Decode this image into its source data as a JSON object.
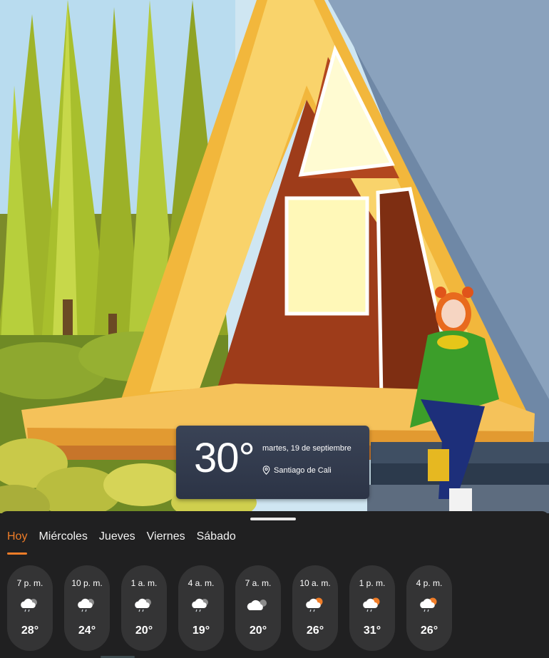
{
  "current": {
    "temperature": "30°",
    "date": "martes, 19 de septiembre",
    "location": "Santiago de Cali",
    "location_icon": "location-pin-icon"
  },
  "tabs": [
    {
      "label": "Hoy",
      "active": true
    },
    {
      "label": "Miércoles",
      "active": false
    },
    {
      "label": "Jueves",
      "active": false
    },
    {
      "label": "Viernes",
      "active": false
    },
    {
      "label": "Sábado",
      "active": false
    }
  ],
  "hourly": [
    {
      "time": "7 p. m.",
      "temp": "28°",
      "icon": "cloud-rain-icon"
    },
    {
      "time": "10 p. m.",
      "temp": "24°",
      "icon": "cloud-rain-icon"
    },
    {
      "time": "1 a. m.",
      "temp": "20°",
      "icon": "cloud-rain-icon"
    },
    {
      "time": "4 a. m.",
      "temp": "19°",
      "icon": "cloud-rain-icon"
    },
    {
      "time": "7 a. m.",
      "temp": "20°",
      "icon": "cloudy-icon"
    },
    {
      "time": "10 a. m.",
      "temp": "26°",
      "icon": "sun-cloud-rain-icon"
    },
    {
      "time": "1 p. m.",
      "temp": "31°",
      "icon": "sun-cloud-rain-icon"
    },
    {
      "time": "4 p. m.",
      "temp": "26°",
      "icon": "sun-cloud-rain-icon"
    }
  ],
  "colors": {
    "accent": "#f07d28",
    "sheet_bg": "#202021",
    "chip_bg": "#343435",
    "card_bg": "#2c3446"
  }
}
